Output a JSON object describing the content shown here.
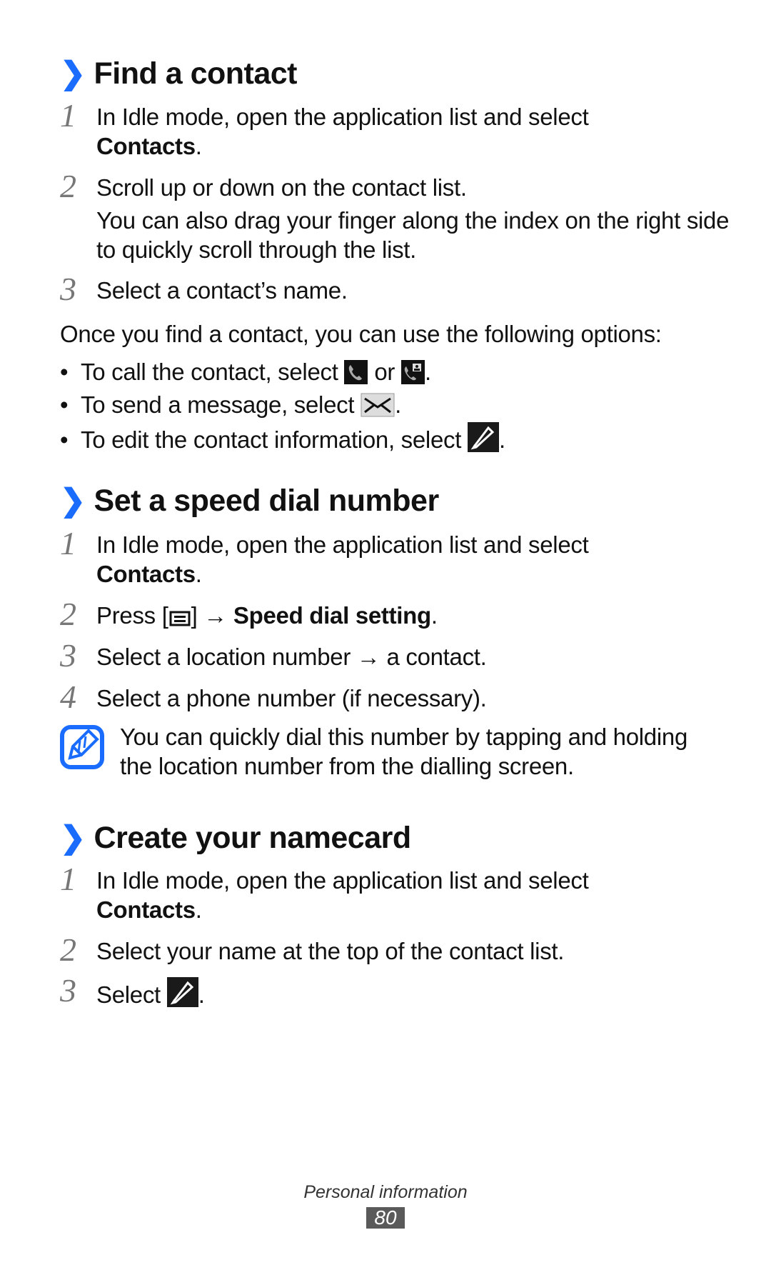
{
  "sections": [
    {
      "title": "Find a contact",
      "steps": [
        {
          "num": "1",
          "text": "In Idle mode, open the application list and select",
          "bold": "Contacts",
          "suffix": "."
        },
        {
          "num": "2",
          "text": "Scroll up or down on the contact list.",
          "extra": "You can also drag your finger along the index on the right side to quickly scroll through the list."
        },
        {
          "num": "3",
          "text": "Select a contact’s name."
        }
      ],
      "intro": "Once you find a contact, you can use the following options:",
      "bullets": [
        {
          "text": "To call the contact, select",
          "mid": "or",
          "suffix": "."
        },
        {
          "text": "To send a message, select",
          "suffix": "."
        },
        {
          "text": "To edit the contact information, select",
          "suffix": "."
        }
      ]
    },
    {
      "title": "Set a speed dial number",
      "steps": [
        {
          "num": "1",
          "text": "In Idle mode, open the application list and select",
          "bold": "Contacts",
          "suffix": "."
        },
        {
          "num": "2",
          "text": "Press [",
          "mid": "] →",
          "bold": "Speed dial setting",
          "suffix": "."
        },
        {
          "num": "3",
          "text": "Select a location number → a contact."
        },
        {
          "num": "4",
          "text": "Select a phone number (if necessary)."
        }
      ],
      "note": "You can quickly dial this number by tapping and holding the location number from the dialling screen."
    },
    {
      "title": "Create your namecard",
      "steps": [
        {
          "num": "1",
          "text": "In Idle mode, open the application list and select",
          "bold": "Contacts",
          "suffix": "."
        },
        {
          "num": "2",
          "text": "Select your name at the top of the contact list."
        },
        {
          "num": "3",
          "text": "Select",
          "suffix": "."
        }
      ]
    }
  ],
  "footer": {
    "label": "Personal information",
    "page": "80"
  },
  "chevron": "❯",
  "bullet_char": "•",
  "colors": {
    "accent": "#1a6cff",
    "page_badge": "#5a5a5a"
  }
}
